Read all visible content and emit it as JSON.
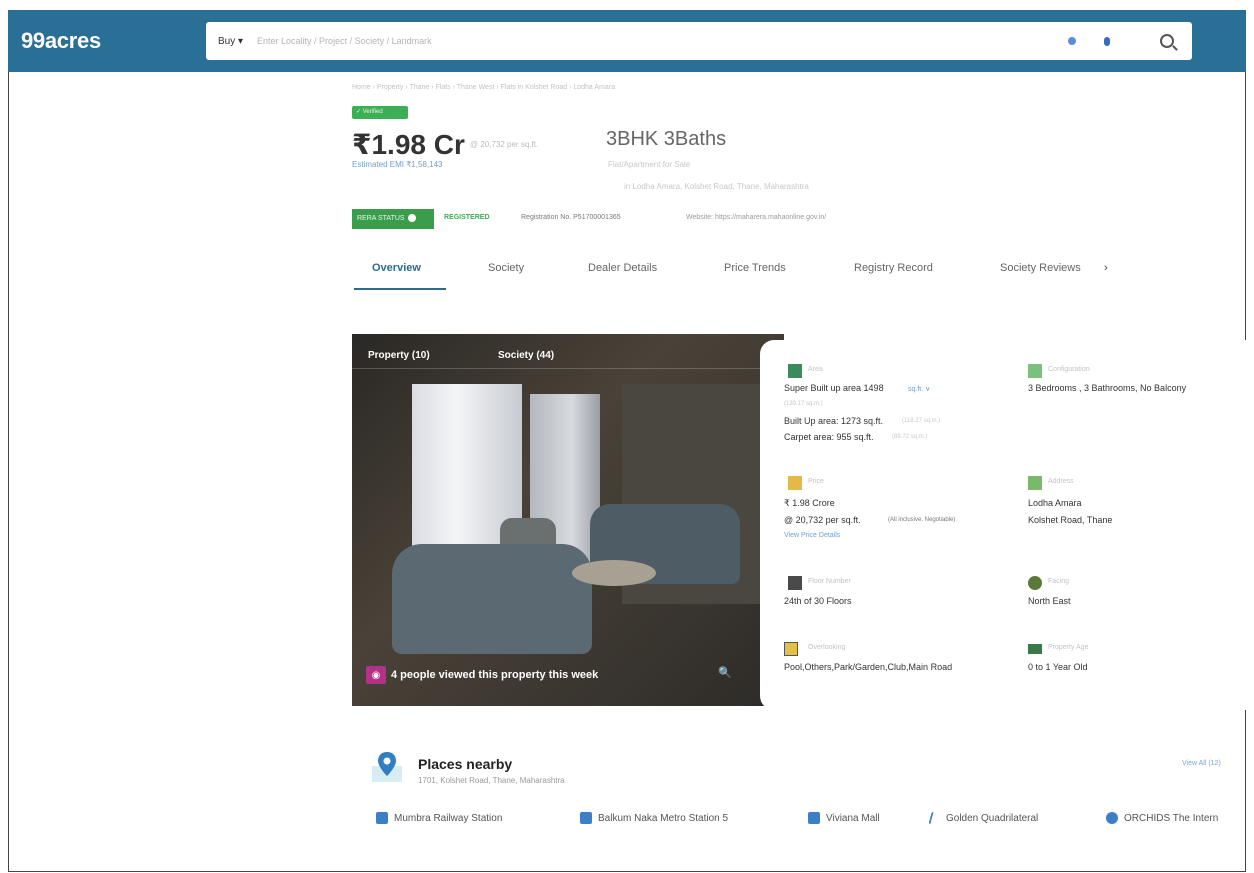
{
  "header": {
    "logo": "99acres",
    "buy_label": "Buy ▾",
    "search_placeholder": "Enter Locality / Project / Society / Landmark"
  },
  "breadcrumb": "Home › Property › Thane › Flats › Thane West › Flats in Kolshet Road › Lodha Amara",
  "listing": {
    "verified": "✓ Verified",
    "price": "₹1.98 Cr",
    "price_per_sqft": "@ 20,732 per sq.ft.",
    "emi": "Estimated EMI ₹1,58,143",
    "bhk": "3BHK 3Baths",
    "property_type": "Flat/Apartment for Sale",
    "locality": "in Lodha Amara, Kolshet Road, Thane, Maharashtra"
  },
  "rera": {
    "badge": "RERA STATUS",
    "status": "REGISTERED",
    "registration": "Registration No. P51700001365",
    "website": "Website: https://maharera.mahaonline.gov.in/"
  },
  "tabs": [
    "Overview",
    "Society",
    "Dealer Details",
    "Price Trends",
    "Registry Record",
    "Society Reviews"
  ],
  "tab_more": "›",
  "gallery": {
    "tab_property": "Property (10)",
    "tab_society": "Society (44)",
    "viewed_text": "4 people viewed this property this week",
    "eye_glyph": "◉",
    "zoom_glyph": "🔍"
  },
  "details": {
    "area_label": "Area",
    "area_value": "Super Built up area 1498",
    "area_unit": "sq.ft. ∨",
    "area_sub": "(139.17 sq.m.)",
    "builtup": "Built Up area: 1273 sq.ft.",
    "builtup_sub": "(118.27 sq.m.)",
    "carpet": "Carpet area: 955 sq.ft.",
    "carpet_sub": "(88.72 sq.m.)",
    "config_label": "Configuration",
    "config_value": "3 Bedrooms , 3 Bathrooms, No Balcony",
    "price_label": "Price",
    "price_value": "₹ 1.98 Crore",
    "price_psf": "@ 20,732 per sq.ft.",
    "price_psf_note": "(All inclusive, Negotiable)",
    "price_link": "View Price Details",
    "address_label": "Address",
    "address_line1": "Lodha Amara",
    "address_line2": "Kolshet Road, Thane",
    "floor_label": "Floor Number",
    "floor_value": "24th of 30 Floors",
    "facing_label": "Facing",
    "facing_value": "North East",
    "overlooking_label": "Overlooking",
    "overlooking_value": "Pool,Others,Park/Garden,Club,Main Road",
    "age_label": "Property Age",
    "age_value": "0 to 1 Year Old"
  },
  "places": {
    "title": "Places nearby",
    "address": "1701, Kolshet Road, Thane, Maharashtra",
    "view_all": "View All (12)",
    "items": [
      "Mumbra Railway Station",
      "Balkum Naka Metro Station 5",
      "Viviana Mall",
      "Golden Quadrilateral",
      "ORCHIDS The Intern"
    ]
  },
  "colors": {
    "header": "#2a6f95",
    "accent": "#2b6d8e",
    "green": "#3cae53",
    "eye_badge": "#b4318a"
  }
}
